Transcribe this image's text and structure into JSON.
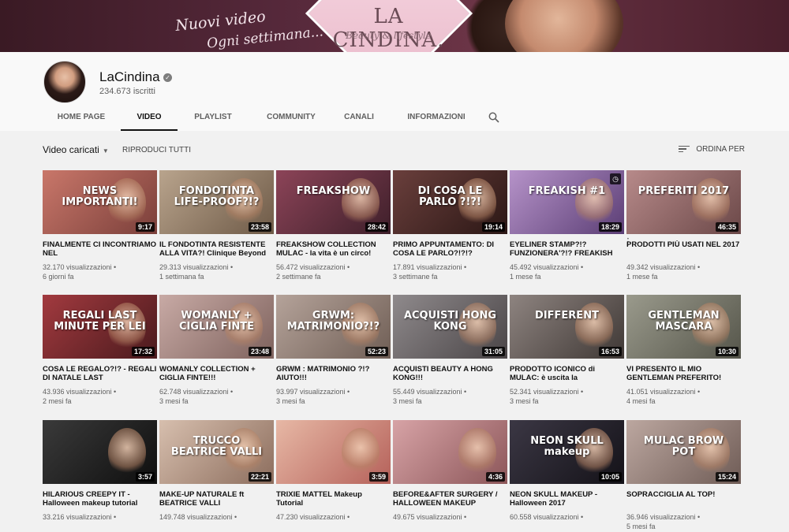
{
  "banner": {
    "tagline_line1": "Nuovi video",
    "tagline_line2": "Ogni settimana...",
    "brand": "LA CINDINA.",
    "brand_sub": "Beauty & lifestyle"
  },
  "channel": {
    "name": "LaCindina",
    "verified_icon": "check-circle-icon",
    "subscribers": "234.673 iscritti"
  },
  "tabs": [
    {
      "label": "HOME PAGE"
    },
    {
      "label": "VIDEO",
      "active": true
    },
    {
      "label": "PLAYLIST"
    },
    {
      "label": "COMMUNITY"
    },
    {
      "label": "CANALI"
    },
    {
      "label": "INFORMAZIONI"
    }
  ],
  "search_icon": "🔍",
  "toolbar": {
    "sort_label": "Video caricati",
    "sort_arrow": "▼",
    "play_all": "RIPRODUCI TUTTI",
    "order_by": "ORDINA PER"
  },
  "videos": [
    {
      "title": "FINALMENTE CI INCONTRIAMO NEL",
      "views": "32.170 visualizzazioni •",
      "age": "6 giorni fa",
      "duration": "9:17",
      "overlay": "NEWS IMPORTANTI!",
      "colors": [
        "#c9776a",
        "#7a3f3a"
      ]
    },
    {
      "title": "IL FONDOTINTA RESISTENTE ALLA VITA?! Clinique Beyond",
      "views": "29.313 visualizzazioni •",
      "age": "1 settimana fa",
      "duration": "23:58",
      "overlay": "FONDOTINTA LIFE-PROOF?!?",
      "colors": [
        "#b9a48d",
        "#6e5a47"
      ]
    },
    {
      "title": "FREAKSHOW COLLECTION MULAC - la vita è un circo!",
      "views": "56.472 visualizzazioni •",
      "age": "2 settimane fa",
      "duration": "28:42",
      "overlay": "FREAKSHOW",
      "colors": [
        "#8c4458",
        "#3e1f2a"
      ]
    },
    {
      "title": "PRIMO APPUNTAMENTO: DI COSA LE PARLO?!?!?",
      "views": "17.891 visualizzazioni •",
      "age": "3 settimane fa",
      "duration": "19:14",
      "overlay": "DI COSA LE PARLO ?!?!",
      "colors": [
        "#6a3f3c",
        "#2b1715"
      ]
    },
    {
      "title": "EYELINER STAMP?!? FUNZIONERA'?!? FREAKISH",
      "views": "45.492 visualizzazioni •",
      "age": "1 mese fa",
      "duration": "18:29",
      "overlay": "FREAKISH #1",
      "colors": [
        "#b693c9",
        "#5b3e75"
      ],
      "menu": true,
      "watch_later": true
    },
    {
      "title": "PRODOTTI PIÙ USATI NEL 2017",
      "views": "49.342 visualizzazioni •",
      "age": "1 mese fa",
      "duration": "46:35",
      "overlay": "PREFERITI 2017",
      "colors": [
        "#b78a8a",
        "#6b4848"
      ]
    },
    {
      "title": "COSA LE REGALO?!? - REGALI DI NATALE LAST",
      "views": "43.936 visualizzazioni •",
      "age": "2 mesi fa",
      "duration": "17:32",
      "overlay": "REGALI LAST MINUTE PER LEI",
      "colors": [
        "#a23a3f",
        "#4a1a1d"
      ]
    },
    {
      "title": "WOMANLY COLLECTION + CIGLIA FINTE!!!",
      "views": "62.748 visualizzazioni •",
      "age": "3 mesi fa",
      "duration": "23:48",
      "overlay": "WOMANLY + CIGLIA FINTE",
      "colors": [
        "#c8aaa5",
        "#7e625d"
      ]
    },
    {
      "title": "GRWM : MATRIMONIO ?!? AIUTO!!!",
      "views": "93.997 visualizzazioni •",
      "age": "3 mesi fa",
      "duration": "52:23",
      "overlay": "GRWM: MATRIMONIO?!?",
      "colors": [
        "#b5a39a",
        "#6f5e55"
      ]
    },
    {
      "title": "ACQUISTI BEAUTY A HONG KONG!!!",
      "views": "55.449 visualizzazioni •",
      "age": "3 mesi fa",
      "duration": "31:05",
      "overlay": "ACQUISTI HONG KONG",
      "colors": [
        "#8f8a8c",
        "#4a4547"
      ]
    },
    {
      "title": "PRODOTTO ICONICO di MULAC: è uscita la",
      "views": "52.341 visualizzazioni •",
      "age": "3 mesi fa",
      "duration": "16:53",
      "overlay": "DIFFERENT",
      "colors": [
        "#8e8480",
        "#3f3835"
      ]
    },
    {
      "title": "VI PRESENTO IL MIO GENTLEMAN PREFERITO!",
      "views": "41.051 visualizzazioni •",
      "age": "4 mesi fa",
      "duration": "10:30",
      "overlay": "GENTLEMAN MASCARA",
      "colors": [
        "#9a9a8c",
        "#55554a"
      ]
    },
    {
      "title": "HILARIOUS CREEPY IT - Halloween makeup tutorial",
      "views": "33.216 visualizzazioni •",
      "age": "",
      "duration": "3:57",
      "overlay": "",
      "colors": [
        "#3a3a3a",
        "#0e0e0e"
      ]
    },
    {
      "title": "MAKE-UP NATURALE ft BEATRICE VALLI",
      "views": "149.748 visualizzazioni •",
      "age": "",
      "duration": "22:21",
      "overlay": "TRUCCO BEATRICE VALLI",
      "colors": [
        "#d7bfae",
        "#8c6d5d"
      ]
    },
    {
      "title": "TRIXIE MATTEL Makeup Tutorial",
      "views": "47.230 visualizzazioni •",
      "age": "",
      "duration": "3:59",
      "overlay": "",
      "colors": [
        "#e7b8a5",
        "#b5615a"
      ]
    },
    {
      "title": "BEFORE&AFTER SURGERY / HALLOWEEN MAKEUP",
      "views": "49.675 visualizzazioni •",
      "age": "",
      "duration": "4:36",
      "overlay": "",
      "colors": [
        "#d7a3a6",
        "#8c5659"
      ]
    },
    {
      "title": "NEON SKULL MAKEUP - Halloween 2017",
      "views": "60.558 visualizzazioni •",
      "age": "",
      "duration": "10:05",
      "overlay": "NEON SKULL makeup",
      "colors": [
        "#3b3744",
        "#141218"
      ]
    },
    {
      "title": "SOPRACCIGLIA AL TOP!",
      "views": "36.946 visualizzazioni •",
      "age": "5 mesi fa",
      "duration": "15:24",
      "overlay": "MULAC BROW POT",
      "colors": [
        "#bca7a0",
        "#6f5c56"
      ]
    }
  ]
}
